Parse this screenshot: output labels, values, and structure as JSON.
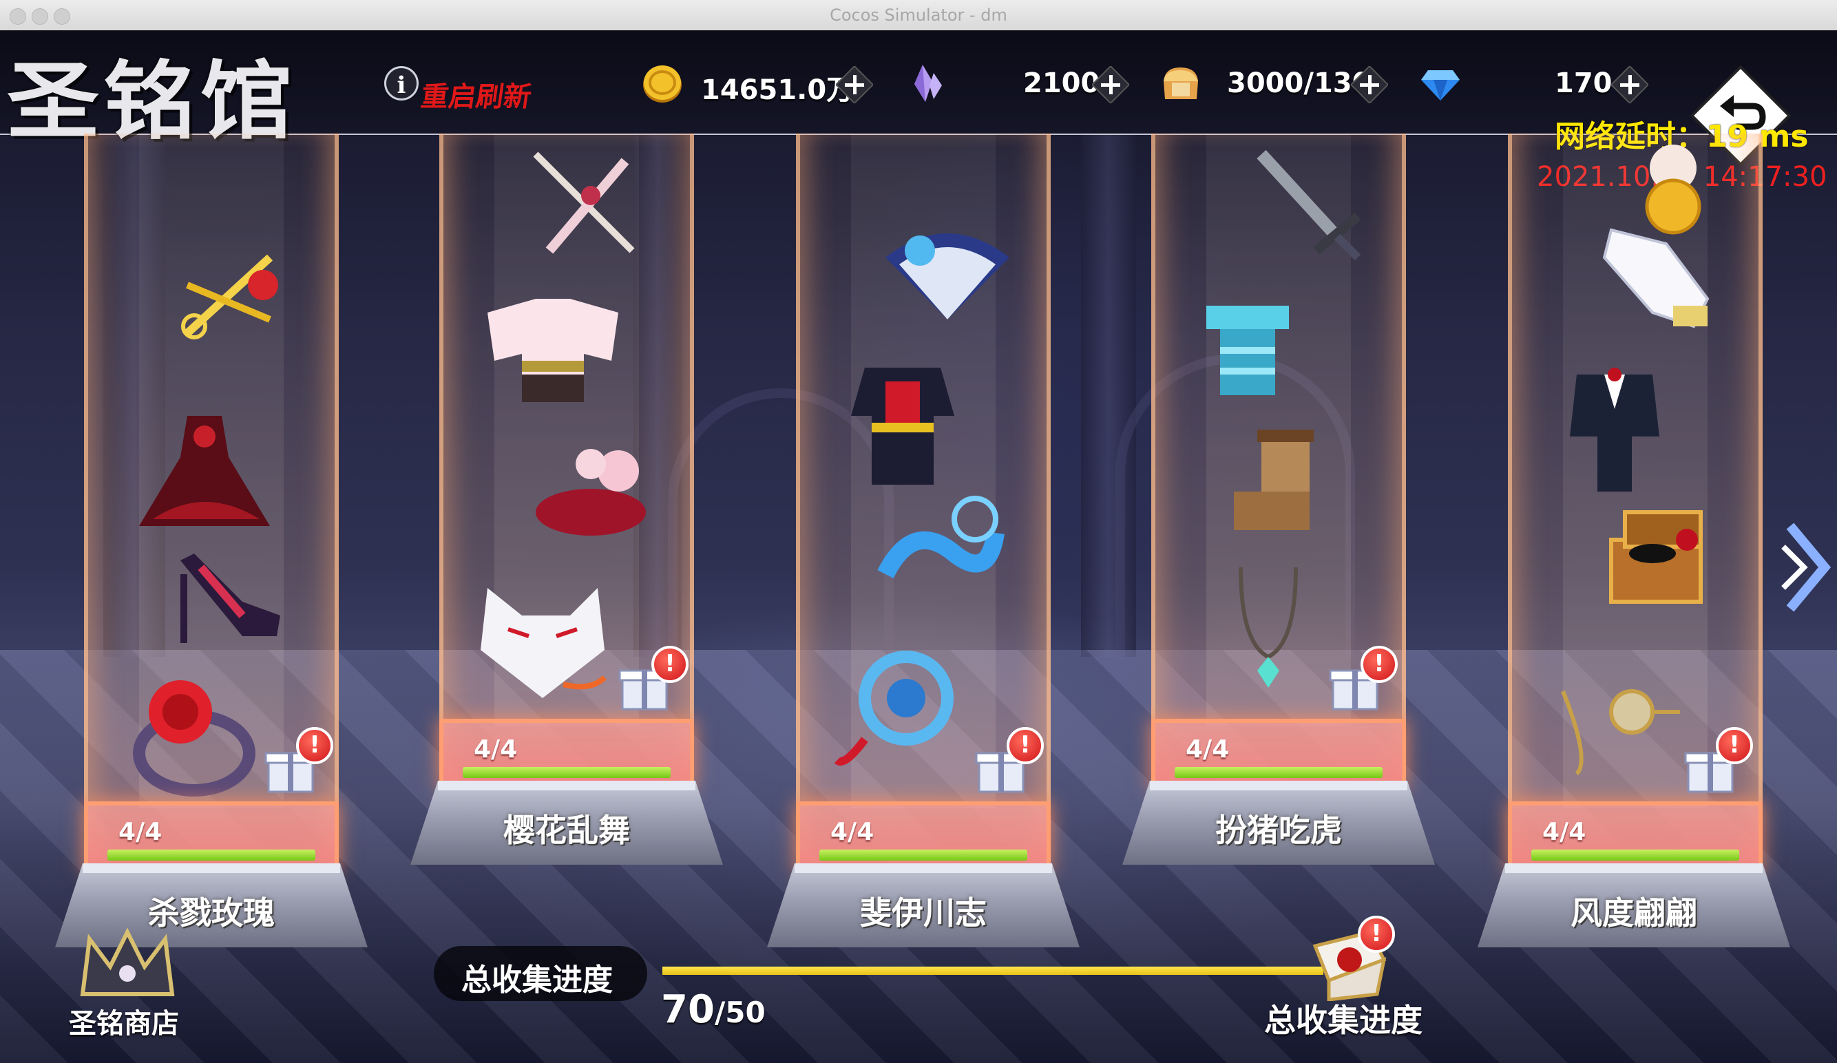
{
  "window": {
    "title": "Cocos Simulator - dm"
  },
  "header": {
    "hall_title": "圣铭馆",
    "refresh_label": "重启刷新",
    "resources": [
      {
        "icon": "gold-coin-icon",
        "value": "14651.0万"
      },
      {
        "icon": "crystal-icon",
        "value": "2100"
      },
      {
        "icon": "bread-stamina-icon",
        "value": "3000/130"
      },
      {
        "icon": "diamond-icon",
        "value": "170"
      }
    ],
    "network_latency": "网络延时：19 ms",
    "datetime": "2021.10.19 14:17:30"
  },
  "showcases": [
    {
      "name": "杀戮玫瑰",
      "progress_text": "4/4",
      "progress": 1.0
    },
    {
      "name": "樱花乱舞",
      "progress_text": "4/4",
      "progress": 1.0
    },
    {
      "name": "斐伊川志",
      "progress_text": "4/4",
      "progress": 1.0
    },
    {
      "name": "扮猪吃虎",
      "progress_text": "4/4",
      "progress": 1.0
    },
    {
      "name": "风度翩翩",
      "progress_text": "4/4",
      "progress": 1.0
    }
  ],
  "alert_mark": "!",
  "shop": {
    "label": "圣铭商店"
  },
  "collection": {
    "label": "总收集进度",
    "current": "70",
    "total": "/50",
    "progress": 1.0,
    "reward_label": "总收集进度"
  },
  "colors": {
    "accent_gold": "#ffe800",
    "alert_red": "#e01818",
    "bar_green": "#74c817",
    "glow_orange": "#ff9e72"
  }
}
